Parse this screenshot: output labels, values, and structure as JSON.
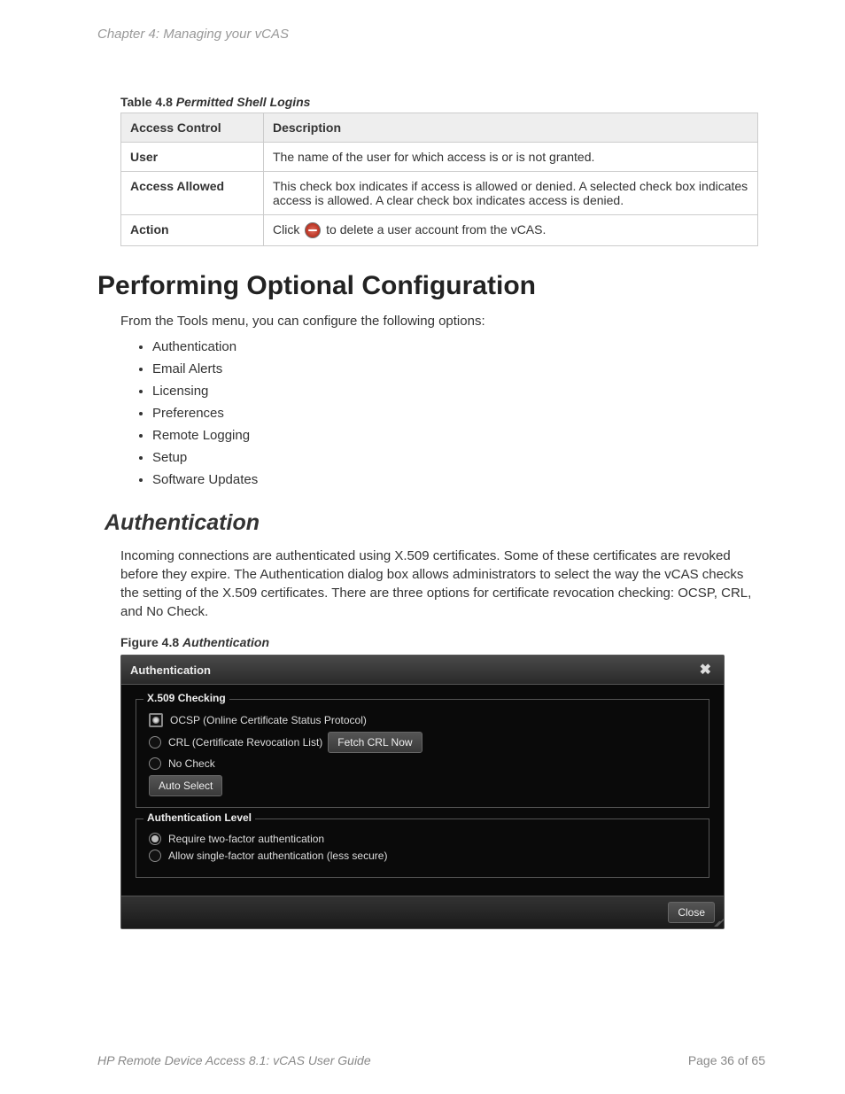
{
  "chapter_header": "Chapter 4: Managing your vCAS",
  "table": {
    "caption_prefix": "Table 4.8 ",
    "caption_title": "Permitted Shell Logins",
    "headers": [
      "Access Control",
      "Description"
    ],
    "rows": [
      {
        "head": "User",
        "desc": "The name of the user for which access is or is not granted."
      },
      {
        "head": "Access Allowed",
        "desc": "This check box indicates if access is allowed or denied. A selected check box indicates access is allowed. A clear check box indicates access is denied."
      },
      {
        "head": "Action",
        "desc_before": "Click ",
        "desc_after": " to delete a user account from the vCAS."
      }
    ]
  },
  "h1": "Performing Optional Configuration",
  "intro": "From the Tools menu, you can configure the following options:",
  "bullets": [
    "Authentication",
    "Email Alerts",
    "Licensing",
    "Preferences",
    "Remote Logging",
    "Setup",
    "Software Updates"
  ],
  "h2": "Authentication",
  "auth_para": "Incoming connections are authenticated using X.509 certificates. Some of these certificates are revoked before they expire. The Authentication dialog box allows administrators to select the way the vCAS checks the setting of the X.509 certificates. There are three options for certificate revocation checking: OCSP, CRL, and No Check.",
  "figure": {
    "prefix": "Figure 4.8 ",
    "title": "Authentication"
  },
  "dialog": {
    "title": "Authentication",
    "close_label": "✖",
    "group1_legend": "X.509 Checking",
    "opt_ocsp": "OCSP (Online Certificate Status Protocol)",
    "opt_crl": "CRL (Certificate Revocation List)",
    "btn_fetch": "Fetch CRL Now",
    "opt_nocheck": "No Check",
    "btn_auto": "Auto Select",
    "group2_legend": "Authentication Level",
    "opt_twofactor": "Require two-factor authentication",
    "opt_single": "Allow single-factor authentication (less secure)",
    "btn_close": "Close",
    "x509_selected": "ocsp",
    "authlevel_selected": "twofactor"
  },
  "footer": {
    "doc_title": "HP Remote Device Access 8.1: vCAS User Guide",
    "page": "Page 36 of 65"
  }
}
